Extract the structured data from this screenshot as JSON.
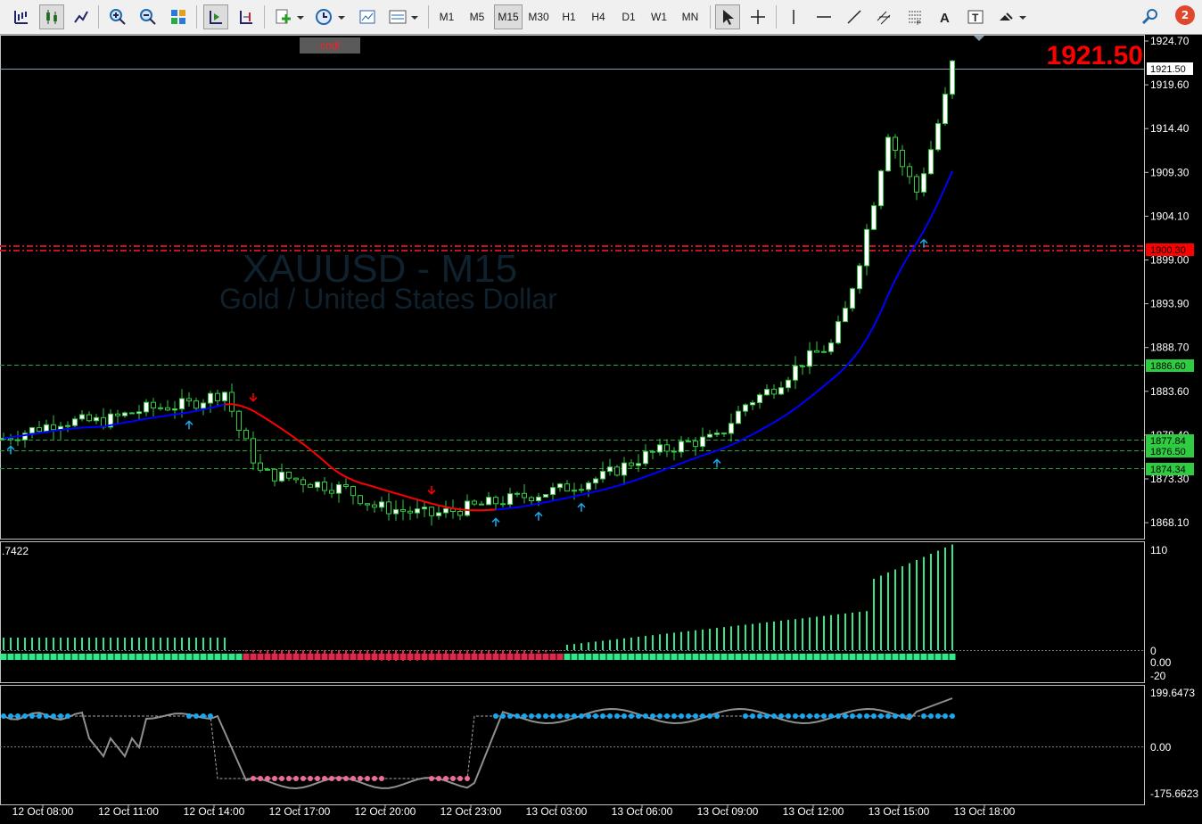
{
  "toolbar": {
    "timeframes": [
      "M1",
      "M5",
      "M15",
      "M30",
      "H1",
      "H4",
      "D1",
      "W1",
      "MN"
    ],
    "active_timeframe": "M15",
    "notification_count": "2"
  },
  "chart": {
    "symbol_title": "XAUUSD - M15",
    "symbol_description": "Gold / United States Dollar",
    "indicator_label": "cndl",
    "current_price_big": "1921.50",
    "bid_label": "1921.50",
    "price_ticks": [
      "1924.70",
      "1919.60",
      "1914.40",
      "1909.30",
      "1904.10",
      "1899.00",
      "1893.90",
      "1888.70",
      "1883.60",
      "1878.40",
      "1873.30",
      "1868.10"
    ],
    "level_labels": [
      {
        "text": "1900.30",
        "color": "#ff0000",
        "text_color": "#000000"
      },
      {
        "text": "1886.60",
        "color": "#2ecc40",
        "text_color": "#000000"
      },
      {
        "text": "1877.84",
        "color": "#2ecc40",
        "text_color": "#000000"
      },
      {
        "text": "1876.50",
        "color": "#2ecc40",
        "text_color": "#000000"
      },
      {
        "text": "1874.34",
        "color": "#2ecc40",
        "text_color": "#000000"
      }
    ],
    "time_labels": [
      "12 Oct 08:00",
      "12 Oct 11:00",
      "12 Oct 14:00",
      "12 Oct 17:00",
      "12 Oct 20:00",
      "12 Oct 23:00",
      "13 Oct 03:00",
      "13 Oct 06:00",
      "13 Oct 09:00",
      "13 Oct 12:00",
      "13 Oct 15:00",
      "13 Oct 18:00"
    ]
  },
  "subwindow1": {
    "value_label": ".7422",
    "ticks": [
      "110",
      "0",
      "0.00",
      "-20"
    ]
  },
  "subwindow2": {
    "ticks": [
      "199.6473",
      "0.00",
      "-175.6623"
    ]
  },
  "colors": {
    "bull_candle": "#ffffff",
    "candle_wick": "#2ecc40",
    "ma_up": "#0000ff",
    "ma_down": "#ff0000",
    "hist_pos": "#2ee88a",
    "hist_neg": "#e0284a",
    "dots_up": "#1aa7ec",
    "dots_down": "#f06c9b"
  }
}
